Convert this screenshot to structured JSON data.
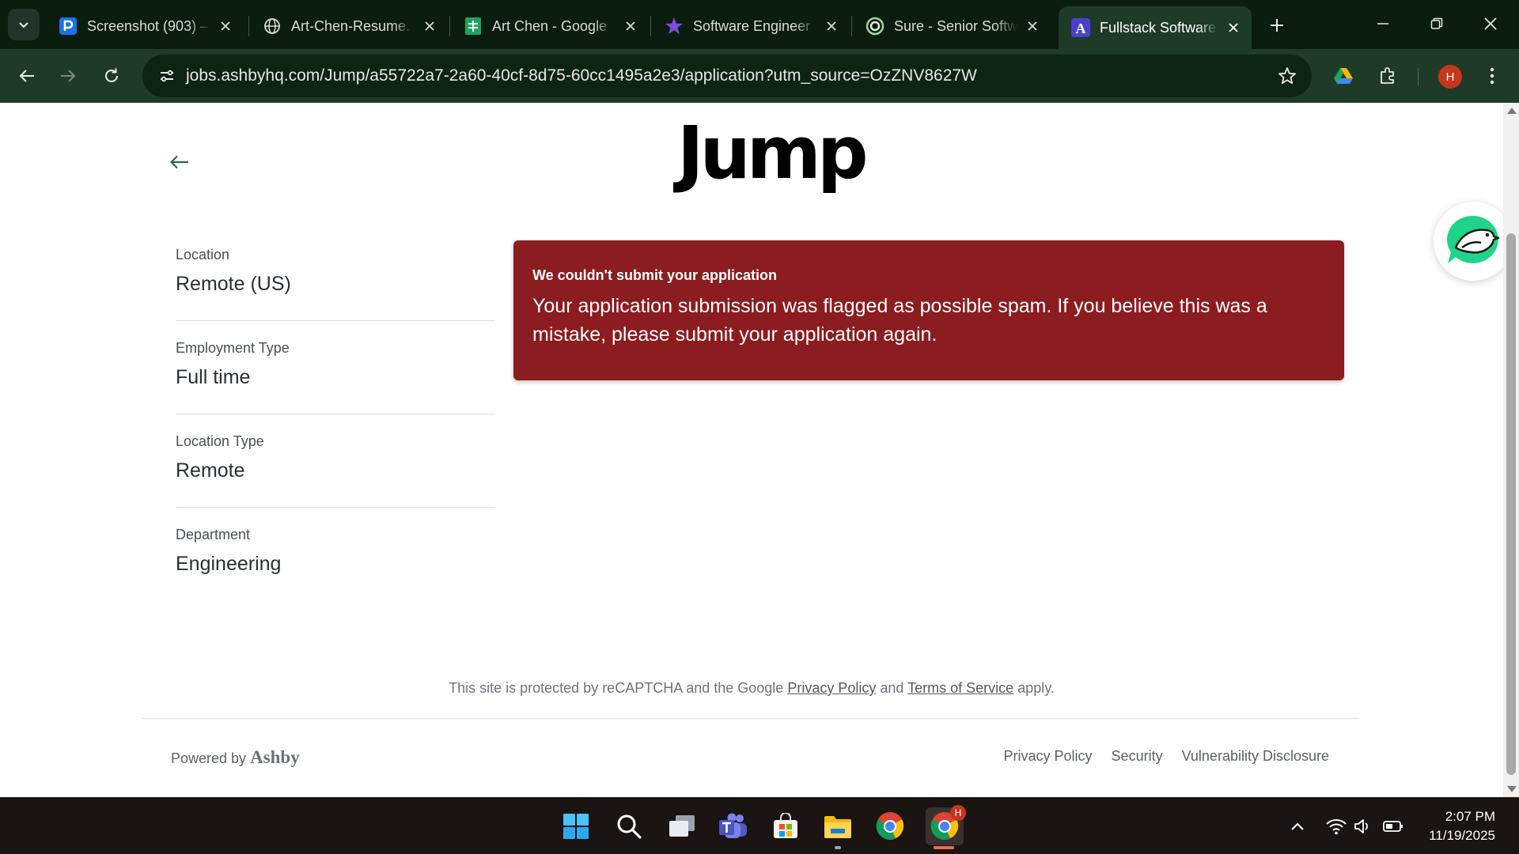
{
  "browser": {
    "tabs": [
      {
        "title": "Screenshot (903) –",
        "icon": "p-app-icon",
        "active": false
      },
      {
        "title": "Art-Chen-Resume.",
        "icon": "globe-icon",
        "active": false
      },
      {
        "title": "Art Chen - Google",
        "icon": "google-sheets-icon",
        "active": false
      },
      {
        "title": "Software Engineer",
        "icon": "purple-star-icon",
        "active": false
      },
      {
        "title": "Sure - Senior Softw",
        "icon": "sure-logo-icon",
        "active": false
      },
      {
        "title": "Fullstack Software",
        "icon": "ashby-a-icon",
        "active": true
      }
    ],
    "url": "jobs.ashbyhq.com/Jump/a55722a7-2a60-40cf-8d75-60cc1495a2e3/application?utm_source=OzZNV8627W",
    "profile_initial": "H",
    "colors": {
      "frame": "#0b1d0e",
      "toolbar": "#1f3a26",
      "profile": "#c4371c"
    }
  },
  "page": {
    "logo_text": "Jump",
    "details": [
      {
        "label": "Location",
        "value": "Remote (US)"
      },
      {
        "label": "Employment Type",
        "value": "Full time"
      },
      {
        "label": "Location Type",
        "value": "Remote"
      },
      {
        "label": "Department",
        "value": "Engineering"
      }
    ],
    "error": {
      "title": "We couldn't submit your application",
      "message": "Your application submission was flagged as possible spam. If you believe this was a mistake, please submit your application again.",
      "color": "#8b1c1f"
    },
    "recaptcha": {
      "prefix": "This site is protected by reCAPTCHA and the Google",
      "privacy_link": "Privacy Policy",
      "middle": "and",
      "terms_link": "Terms of Service",
      "suffix": "apply."
    },
    "footer": {
      "powered_by": "Powered by",
      "brand": "Ashby",
      "links": [
        "Privacy Policy",
        "Security",
        "Vulnerability Disclosure"
      ]
    }
  },
  "taskbar": {
    "apps": [
      "windows-start-icon",
      "search-icon",
      "task-view-icon",
      "teams-icon",
      "microsoft-store-icon",
      "file-explorer-icon",
      "chrome-icon",
      "chrome-profile-icon"
    ],
    "badge": "H",
    "time": "2:07 PM",
    "date": "11/19/2025"
  }
}
